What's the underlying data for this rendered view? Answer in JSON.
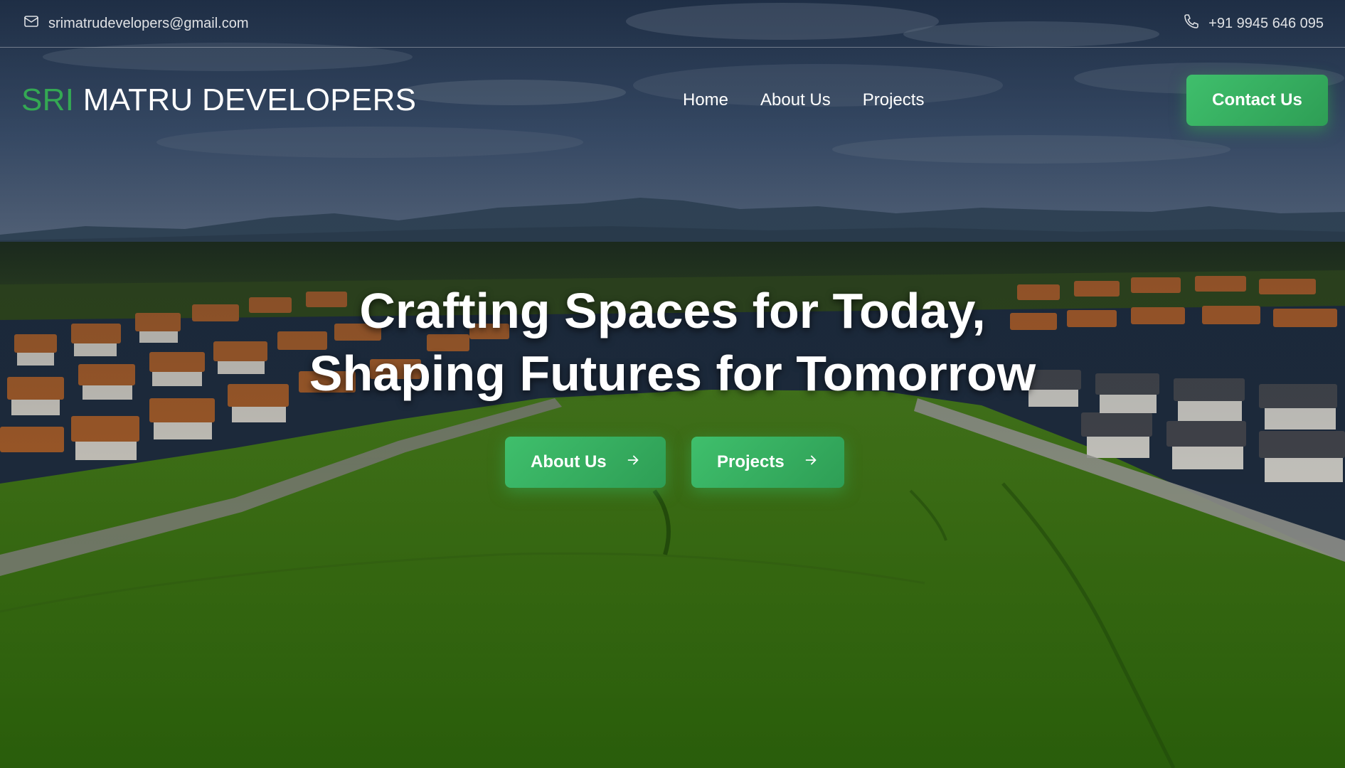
{
  "topbar": {
    "email": "srimatrudevelopers@gmail.com",
    "phone": "+91 9945 646 095",
    "email_icon": "mail-icon",
    "phone_icon": "phone-icon"
  },
  "header": {
    "logo_accent": "SRI",
    "logo_main": "MATRU DEVELOPERS",
    "nav": [
      "Home",
      "About Us",
      "Projects"
    ],
    "contact_label": "Contact Us"
  },
  "hero": {
    "title_line1": "Crafting Spaces for Today,",
    "title_line2": "Shaping Futures for Tomorrow",
    "buttons": [
      "About Us",
      "Projects"
    ],
    "button_icon": "arrow-right-icon"
  },
  "colors": {
    "accent": "#34a853",
    "button_gradient_start": "#3fbf6c",
    "button_gradient_end": "#2e9e55"
  }
}
